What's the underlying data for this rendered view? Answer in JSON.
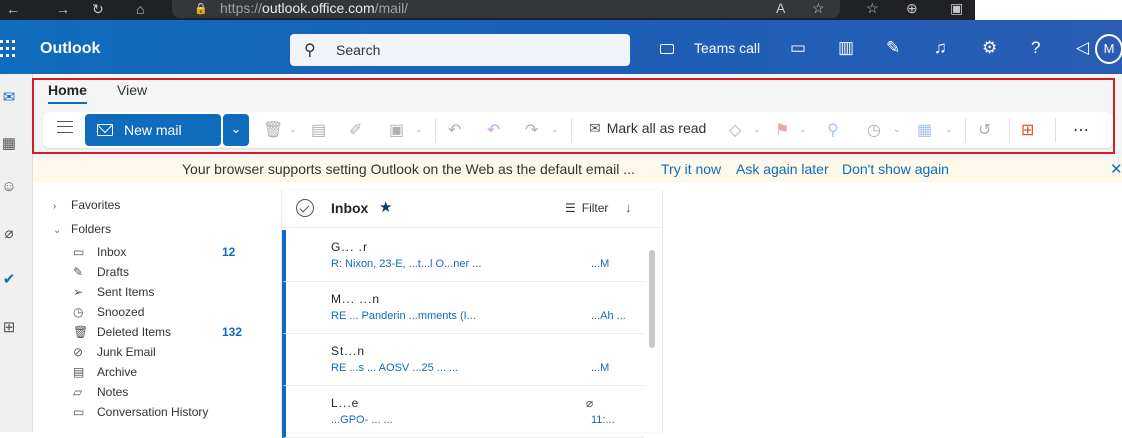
{
  "browser": {
    "url_prefix": "https://",
    "url_host": "outlook.office.com",
    "url_path": "/mail/"
  },
  "header": {
    "brand": "Outlook",
    "search_placeholder": "Search",
    "teams_call": "Teams call",
    "avatar_initial": "M"
  },
  "ribbon": {
    "tabs": [
      "Home",
      "View"
    ],
    "new_mail": "New mail",
    "mark_all_read": "Mark all as read"
  },
  "infobar": {
    "message": "Your browser supports setting Outlook on the Web as the default email ...",
    "try_it_now": "Try it now",
    "ask_again_later": "Ask again later",
    "dont_show_again": "Don't show again"
  },
  "folders": {
    "favorites": "Favorites",
    "folders_label": "Folders",
    "items": [
      {
        "label": "Inbox",
        "count": "12",
        "icon": "inbox-icon"
      },
      {
        "label": "Drafts",
        "count": "",
        "icon": "drafts-icon"
      },
      {
        "label": "Sent Items",
        "count": "",
        "icon": "send-icon"
      },
      {
        "label": "Snoozed",
        "count": "",
        "icon": "clock-icon"
      },
      {
        "label": "Deleted Items",
        "count": "132",
        "icon": "trash-icon"
      },
      {
        "label": "Junk Email",
        "count": "",
        "icon": "junk-icon"
      },
      {
        "label": "Archive",
        "count": "",
        "icon": "archive-icon"
      },
      {
        "label": "Notes",
        "count": "",
        "icon": "notes-icon"
      },
      {
        "label": "Conversation History",
        "count": "",
        "icon": "folder-icon"
      }
    ]
  },
  "mail_list": {
    "title": "Inbox",
    "filter": "Filter",
    "messages": [
      {
        "sender": "G... .r",
        "subject": "R: Nixon, 23-E, ...t...l O...ner ...",
        "time": "...M"
      },
      {
        "sender": "M... ...n",
        "subject": "RE ... Panderin ...mments (I...",
        "time": "...Ah ..."
      },
      {
        "sender": "St...n",
        "subject": "RE ...s ... AOSV ...25 ... ...",
        "time": "...M"
      },
      {
        "sender": "L...e",
        "subject": "...GPO- ... ...",
        "time": "11:..."
      }
    ]
  }
}
